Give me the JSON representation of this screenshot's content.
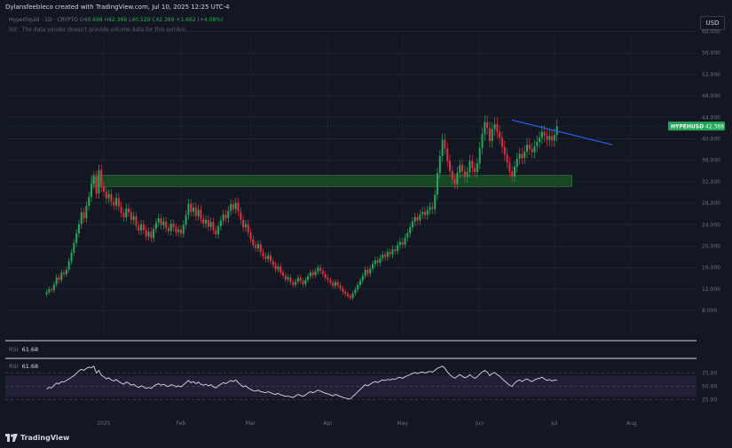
{
  "caption": "Dylansfeebleco created with TradingView.com, Jul 10, 2025 12:25 UTC-4",
  "legend": {
    "symbol": "Hyperliquid · 1D · CRYPTO",
    "open": "40.698",
    "high": "42.369",
    "low": "40.529",
    "close": "42.369",
    "change": "+1.662 (+4.08%)"
  },
  "volume_note": "Vol · The data vendor doesn't provide volume data for this symbol.",
  "currency_button": "USD",
  "price_tag": {
    "symbol": "HYPEHUSD",
    "value": "42.369",
    "color": "#26a65b"
  },
  "rsi_pane_label": {
    "key": "RSI",
    "value": "61.68"
  },
  "rsi_label": {
    "key": "RSI",
    "value": "61.68"
  },
  "branding": "TradingView",
  "colors": {
    "background": "#131722",
    "up": "#26a65b",
    "down": "#e0303f",
    "trendline": "#2962ff",
    "zone": "#1e6b2a",
    "rsi_line": "#d8dae0",
    "rsi_band": "#2a2440"
  },
  "chart_data": [
    {
      "type": "candlestick",
      "title": "",
      "x_tick_labels": [
        "2025",
        "Feb",
        "Mar",
        "Apr",
        "May",
        "Jun",
        "Jul",
        "Aug"
      ],
      "y_tick_labels": [
        "8.000",
        "12.000",
        "16.000",
        "20.000",
        "24.000",
        "28.000",
        "32.000",
        "36.000",
        "40.000",
        "44.000",
        "48.000",
        "52.000",
        "56.000",
        "60.000"
      ],
      "ylim": [
        6,
        62
      ],
      "grid": true,
      "annotations": {
        "support_zone": [
          31.1,
          33.2
        ],
        "trendline": [
          {
            "date": "Jun 04",
            "price": 43.5
          },
          {
            "date": "Jul 18",
            "price": 38.9
          }
        ]
      },
      "series": [
        {
          "close_by_day": [
            11.4,
            12.0,
            11.8,
            12.9,
            14.2,
            13.7,
            15.1,
            14.8,
            15.6,
            17.2,
            18.8,
            20.6,
            22.4,
            24.1,
            26.3,
            25.2,
            27.5,
            29.2,
            31.6,
            33.0,
            29.8,
            34.2,
            31.0,
            30.2,
            28.9,
            29.7,
            28.3,
            27.6,
            29.0,
            27.4,
            26.2,
            25.4,
            27.0,
            26.3,
            24.9,
            25.6,
            23.8,
            22.9,
            24.1,
            23.0,
            21.8,
            22.7,
            21.5,
            23.2,
            24.4,
            25.2,
            23.9,
            24.6,
            23.4,
            22.8,
            24.2,
            23.5,
            22.6,
            23.1,
            22.3,
            24.0,
            25.8,
            27.9,
            26.4,
            27.2,
            25.6,
            26.8,
            25.1,
            24.2,
            24.9,
            23.6,
            24.5,
            23.0,
            22.2,
            23.7,
            24.8,
            25.9,
            25.2,
            26.6,
            27.8,
            26.9,
            28.1,
            26.4,
            24.9,
            23.5,
            24.1,
            22.6,
            21.3,
            20.2,
            19.6,
            20.4,
            18.9,
            18.1,
            17.6,
            18.3,
            17.2,
            16.5,
            15.7,
            16.2,
            15.1,
            14.5,
            13.8,
            14.2,
            13.3,
            12.8,
            13.4,
            14.1,
            13.5,
            12.9,
            13.7,
            14.4,
            15.1,
            14.6,
            15.3,
            16.0,
            15.4,
            14.8,
            14.1,
            13.7,
            13.2,
            12.6,
            13.3,
            12.7,
            12.1,
            11.5,
            11.1,
            10.7,
            10.4,
            11.2,
            11.9,
            12.8,
            13.6,
            14.5,
            15.6,
            14.9,
            15.8,
            16.7,
            17.4,
            16.9,
            17.8,
            18.4,
            18.0,
            18.9,
            18.5,
            19.4,
            19.1,
            20.2,
            20.8,
            20.3,
            21.6,
            22.4,
            23.5,
            24.6,
            25.4,
            24.8,
            25.9,
            26.4,
            25.8,
            26.7,
            27.3,
            26.9,
            29.6,
            33.6,
            36.8,
            39.8,
            38.2,
            35.9,
            34.0,
            32.5,
            31.6,
            33.7,
            35.1,
            34.0,
            32.9,
            33.8,
            35.9,
            34.6,
            33.8,
            35.4,
            38.3,
            40.9,
            43.1,
            42.0,
            39.6,
            41.8,
            42.7,
            41.3,
            40.2,
            38.5,
            37.1,
            35.6,
            33.9,
            33.0,
            34.8,
            36.3,
            37.2,
            36.4,
            37.6,
            38.9,
            38.1,
            37.5,
            38.6,
            39.4,
            40.2,
            41.3,
            40.6,
            39.8,
            40.5,
            39.7,
            40.7,
            42.37
          ]
        },
        {
          "name": "RSI",
          "values_by_day": [
            45,
            48,
            47,
            52,
            56,
            55,
            59,
            58,
            61,
            64,
            67,
            70,
            74,
            79,
            82,
            80,
            84,
            86,
            85,
            88,
            75,
            80,
            71,
            68,
            64,
            66,
            62,
            60,
            63,
            59,
            56,
            54,
            58,
            56,
            52,
            54,
            50,
            48,
            51,
            49,
            46,
            48,
            46,
            50,
            53,
            55,
            52,
            54,
            51,
            50,
            53,
            52,
            49,
            51,
            49,
            53,
            57,
            61,
            57,
            59,
            55,
            58,
            54,
            52,
            54,
            51,
            53,
            49,
            47,
            51,
            54,
            57,
            55,
            58,
            61,
            59,
            62,
            57,
            53,
            49,
            51,
            47,
            44,
            42,
            41,
            43,
            40,
            39,
            38,
            40,
            38,
            36,
            35,
            37,
            34,
            33,
            31,
            32,
            30,
            29,
            32,
            35,
            33,
            31,
            34,
            37,
            40,
            38,
            40,
            43,
            41,
            39,
            37,
            36,
            34,
            32,
            35,
            33,
            31,
            29,
            28,
            27,
            26,
            31,
            35,
            40,
            44,
            49,
            53,
            51,
            54,
            57,
            59,
            57,
            60,
            62,
            61,
            63,
            62,
            64,
            63,
            66,
            67,
            65,
            68,
            70,
            72,
            74,
            76,
            74,
            76,
            77,
            75,
            77,
            78,
            77,
            80,
            84,
            86,
            88,
            84,
            77,
            72,
            68,
            65,
            69,
            72,
            69,
            66,
            68,
            72,
            68,
            65,
            68,
            73,
            77,
            80,
            77,
            70,
            74,
            76,
            72,
            69,
            64,
            60,
            56,
            52,
            50,
            56,
            60,
            62,
            59,
            62,
            64,
            61,
            59,
            62,
            64,
            65,
            67,
            64,
            61,
            63,
            60,
            62,
            61.68
          ]
        }
      ]
    }
  ]
}
